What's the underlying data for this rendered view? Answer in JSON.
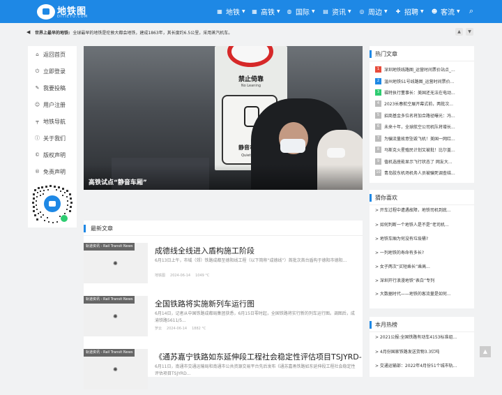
{
  "header": {
    "logo_text": "地铁图",
    "logo_sub": "DITIETU.COM",
    "nav": [
      {
        "label": "地铁",
        "icon": "subway-icon"
      },
      {
        "label": "高铁",
        "icon": "train-icon"
      },
      {
        "label": "国际",
        "icon": "globe-icon"
      },
      {
        "label": "资讯",
        "icon": "news-icon"
      },
      {
        "label": "周边",
        "icon": "compass-icon"
      },
      {
        "label": "招聘",
        "icon": "user-plus-icon"
      },
      {
        "label": "客流",
        "icon": "people-icon"
      }
    ]
  },
  "ticker": {
    "title": "世界上最早的地铁:",
    "text": "全球最早的地铁是伦敦大都会地铁，建成1863年，其长度约6.5公里，采用蒸汽机车。"
  },
  "sidebar": {
    "items": [
      {
        "label": "返回首页",
        "icon": "home-icon"
      },
      {
        "label": "立即登录",
        "icon": "power-icon"
      },
      {
        "label": "我要投稿",
        "icon": "pencil-icon"
      },
      {
        "label": "用户注册",
        "icon": "user-icon"
      },
      {
        "label": "地铁导航",
        "icon": "subway-nav-icon"
      },
      {
        "label": "关于我们",
        "icon": "info-icon"
      },
      {
        "label": "版权声明",
        "icon": "copyright-icon"
      },
      {
        "label": "免责声明",
        "icon": "registered-icon"
      }
    ]
  },
  "hero": {
    "caption": "高铁试点“静音车厢”",
    "sign_top": "禁止倚靠",
    "sign_top_en": "No Leaning",
    "sign_mid": "静音车厢",
    "sign_mid_en": "Quiet Car"
  },
  "latest": {
    "heading": "最新文章",
    "articles": [
      {
        "tag": "轨道资讯 - Rail Transit News",
        "title": "成德线全线进入盾构施工阶段",
        "desc": "6月13日上午，市域（郊）铁路成都至德阳线工程（以下简称“成德线”）首批次首台盾构于德阳市德阳...",
        "author": "地铁图",
        "date": "2024-06-14",
        "temp": "1049 °C"
      },
      {
        "tag": "轨道资讯 - Rail Transit News",
        "title": "全国铁路将实施新列车运行图",
        "desc": "6月14日，记者从中国铁路成都局集团获悉，6月15日零时起，全国铁路将实行新的列车运行图。调图后，成渝铁路5611/5...",
        "author": "罗云",
        "date": "2024-06-14",
        "temp": "1882 °C"
      },
      {
        "tag": "轨道资讯 - Rail Transit News",
        "title": "《通苏嘉宁铁路如东延伸段工程社会稳定性评估项目TSJYRD-",
        "desc": "6月11日，南通市交通运输局和南通市公共资源交易平台先后发布《通苏嘉甬铁路如东延伸段工程社会稳定性评估项目TSJYRD...",
        "author": "",
        "date": "",
        "temp": ""
      }
    ]
  },
  "hot": {
    "heading": "热门文章",
    "items": [
      "深圳地铁线路图_运营时间票价站点_...",
      "温州地铁S1号线路图_运营时间票价...",
      "福特执行董事长：美国还无法在电动...",
      "2023长春航空展开幕式前，两批次...",
      "招商基金多位名将加合路径曝光：冯...",
      "未来十年，全球航空公司机队将增长...",
      "为骗流量故意坠毁飞机！美国一网红...",
      "马斯克火星殖民计划又被批！比尔盖...",
      "值机选座能显示飞行状态了 网友大...",
      "青岛胶东机场机务人员被骗死调查结..."
    ],
    "colors": [
      "#e74c3c",
      "#1e88e5",
      "#2ecc71",
      "#bbbbbb"
    ]
  },
  "guess": {
    "heading": "猜你喜欢",
    "items": [
      "> 开车过程中遭遇故障，地铁司机到底...",
      "> 如何判断一个地铁人是不是“老司机...",
      "> 地铁车厢为何没有垃圾桶?",
      "> 一列地铁的寿命有多长?",
      "> 女子两次“买短乘长”乘高...",
      "> 深圳开行浪漫地铁“表白”专列",
      "> 大数据时代——地铁的客流量是如何..."
    ]
  },
  "monthly": {
    "heading": "本月热榜",
    "items": [
      "> 2021公报:全国铁路有动车4153标准组...",
      "> 4月份国家铁路发送货物3.3亿吨",
      "> 交通运输部：2022年4月份51个城市轨..."
    ]
  }
}
